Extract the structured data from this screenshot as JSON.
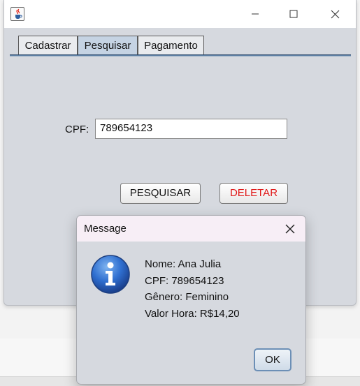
{
  "window": {
    "title": "",
    "icon": "java-cup-icon",
    "controls": [
      "minimize-icon",
      "maximize-icon",
      "close-icon"
    ]
  },
  "tabs": [
    {
      "label": "Cadastrar",
      "selected": false
    },
    {
      "label": "Pesquisar",
      "selected": true
    },
    {
      "label": "Pagamento",
      "selected": false
    }
  ],
  "search_form": {
    "cpf_label": "CPF:",
    "cpf_value": "789654123",
    "search_button": "PESQUISAR",
    "delete_button": "DELETAR"
  },
  "dialog": {
    "title": "Message",
    "icon": "info-icon",
    "lines": [
      "Nome: Ana Julia",
      "CPF: 789654123",
      "Gênero: Feminino",
      "Valor Hora: R$14,20"
    ],
    "ok_button": "OK"
  },
  "colors": {
    "panel_background": "#d6d9df",
    "selected_tab": "#c5d3e3",
    "delete_text": "#e01818",
    "dialog_titlebar": "#f7eef6"
  }
}
